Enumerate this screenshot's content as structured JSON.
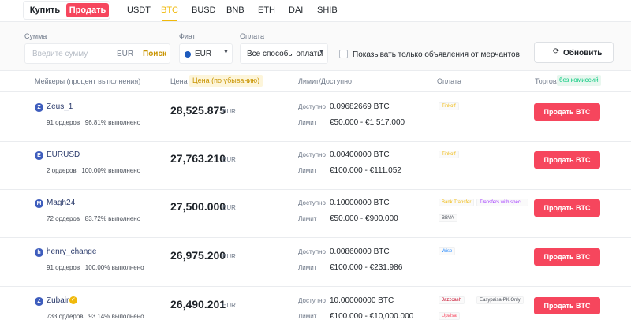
{
  "toggle": {
    "buy_label": "Купить",
    "sell_label": "Продать"
  },
  "coin_tabs": [
    "USDT",
    "BTC",
    "BUSD",
    "BNB",
    "ETH",
    "DAI",
    "SHIB"
  ],
  "active_coin": "BTC",
  "filters": {
    "amount_label": "Сумма",
    "amount_placeholder": "Введите сумму",
    "amount_currency": "EUR",
    "search_label": "Поиск",
    "fiat_label": "Фиат",
    "fiat_value": "EUR",
    "payment_label": "Оплата",
    "payment_value": "Все способы оплаты",
    "merchants_only_label": "Показывать только объявления от мерчантов",
    "merchants_only_checked": false,
    "refresh_label": "Обновить"
  },
  "table_headers": {
    "makers": "Мейкеры (процент выполнения)",
    "price": "Цена",
    "price_sort": "Цена (по убыванию)",
    "limit": "Лимит/Доступно",
    "payment": "Оплата",
    "trade": "Торговля",
    "no_fee": "без комиссий"
  },
  "row_labels": {
    "available": "Доступно",
    "limit": "Лимит",
    "currency": "EUR",
    "sell_button": "Продать BTC"
  },
  "offers": [
    {
      "initial": "Z",
      "name": "Zeus_1",
      "verified": false,
      "orders": "91 ордеров",
      "completion": "96.81% выполнено",
      "price": "28,525.875",
      "available": "0.09682669 BTC",
      "limit": "€50.000 - €1,517.000",
      "payments": [
        "Tinkoff"
      ]
    },
    {
      "initial": "E",
      "name": "EURUSD",
      "verified": false,
      "orders": "2 ордеров",
      "completion": "100.00% выполнено",
      "price": "27,763.210",
      "available": "0.00400000 BTC",
      "limit": "€100.000 - €111.052",
      "payments": [
        "Tinkoff"
      ]
    },
    {
      "initial": "M",
      "name": "Magh24",
      "verified": false,
      "orders": "72 ордеров",
      "completion": "83.72% выполнено",
      "price": "27,500.000",
      "available": "0.10000000 BTC",
      "limit": "€50.000 - €900.000",
      "payments": [
        "Bank Transfer",
        "Transfers with speci...",
        "BBVA"
      ]
    },
    {
      "initial": "h",
      "name": "henry_change",
      "verified": false,
      "orders": "91 ордеров",
      "completion": "100.00% выполнено",
      "price": "26,975.200",
      "available": "0.00860000 BTC",
      "limit": "€100.000 - €231.986",
      "payments": [
        "Wise"
      ]
    },
    {
      "initial": "Z",
      "name": "Zubair",
      "verified": true,
      "orders": "733 ордеров",
      "completion": "93.14% выполнено",
      "price": "26,490.201",
      "available": "10.00000000 BTC",
      "limit": "€100.000 - €10,000.000",
      "payments": [
        "Jazzcash",
        "Easypaisa-PK Only",
        "Upaisa"
      ]
    }
  ],
  "colors": {
    "accent": "#f0b90b",
    "sell": "#f6465d",
    "green": "#0ecb81"
  },
  "payment_colors": {
    "Tinkoff": "#f0b90b",
    "Bank Transfer": "#f0b90b",
    "Transfers with speci...": "#a238ff",
    "BBVA": "#474d57",
    "Wise": "#2a8cff",
    "Jazzcash": "#c8102e",
    "Easypaisa-PK Only": "#474d57",
    "Upaisa": "#f6465d"
  }
}
